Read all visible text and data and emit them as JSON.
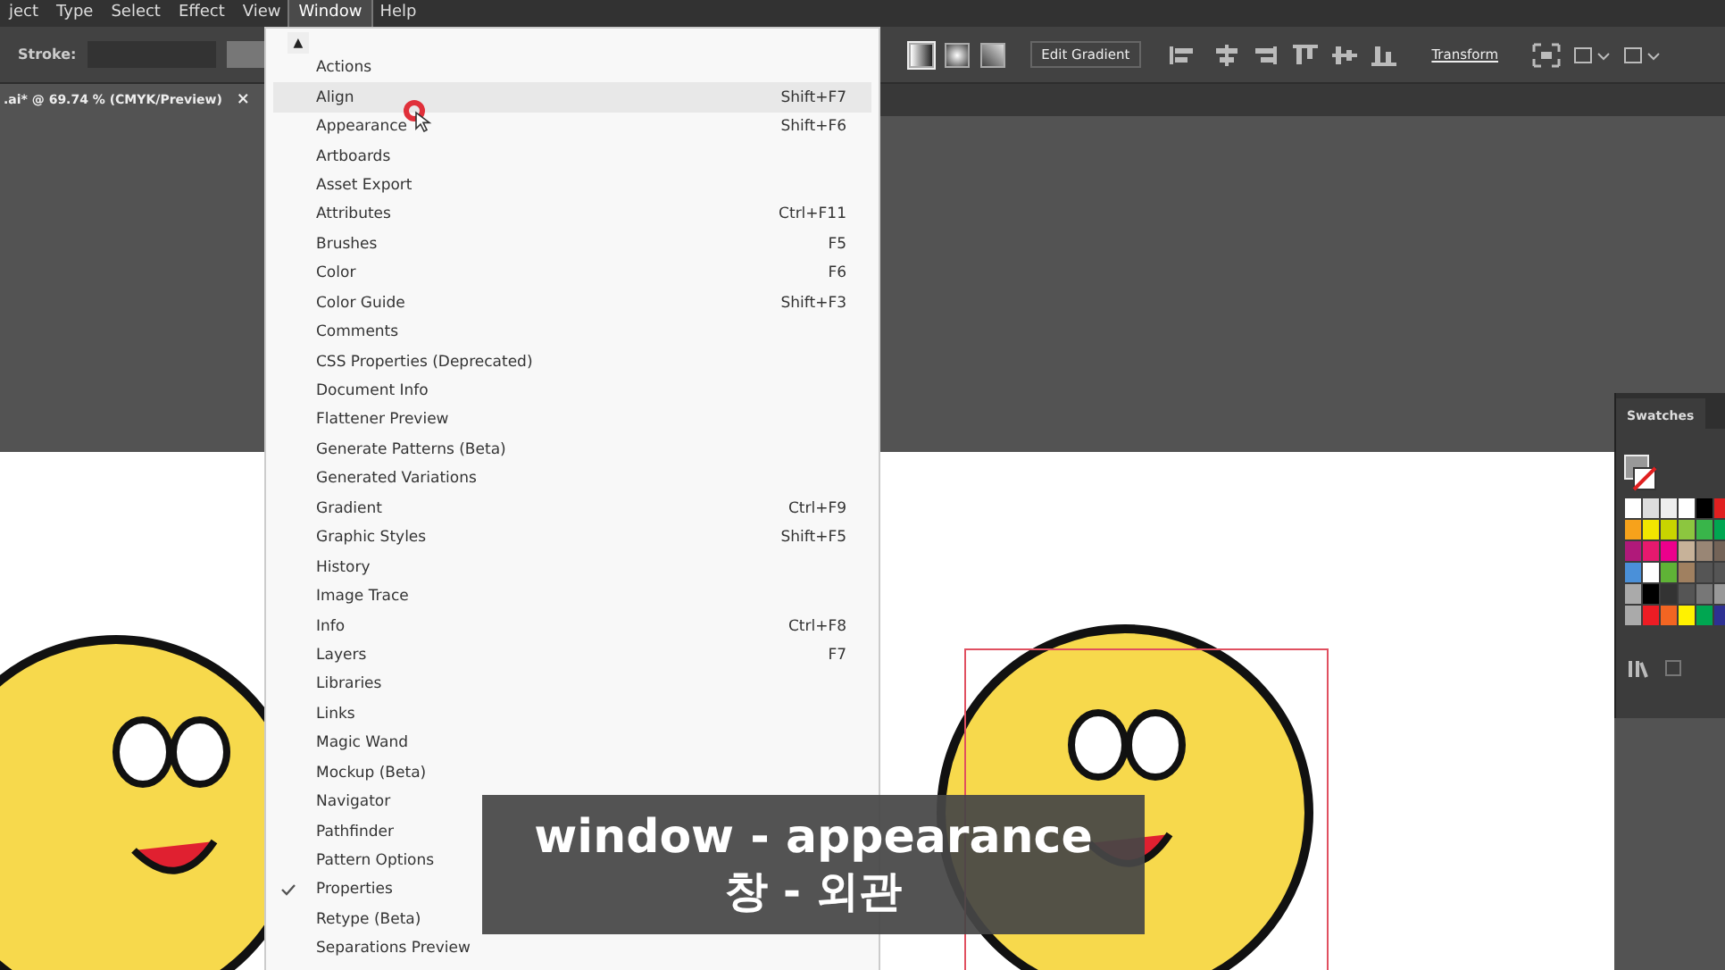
{
  "menu_bar": [
    {
      "label": "ject",
      "selected": false
    },
    {
      "label": "Type",
      "selected": false
    },
    {
      "label": "Select",
      "selected": false
    },
    {
      "label": "Effect",
      "selected": false
    },
    {
      "label": "View",
      "selected": false
    },
    {
      "label": "Window",
      "selected": true
    },
    {
      "label": "Help",
      "selected": false
    }
  ],
  "control_bar": {
    "stroke_label": "Stroke:",
    "edit_gradient": "Edit Gradient",
    "transform": "Transform"
  },
  "document_tab": {
    "title": ".ai* @ 69.74 % (CMYK/Preview)",
    "close": "×"
  },
  "window_menu": {
    "scroll_up": "▲",
    "items": [
      {
        "label": "Actions",
        "checked": false,
        "highlighted": false
      },
      {
        "label": "Align",
        "shortcut": "Shift+F7",
        "checked": false,
        "highlighted": true
      },
      {
        "label": "Appearance",
        "shortcut": "Shift+F6",
        "checked": false,
        "highlighted": false
      },
      {
        "label": "Artboards",
        "checked": false,
        "highlighted": false
      },
      {
        "label": "Asset Export",
        "checked": false,
        "highlighted": false
      },
      {
        "label": "Attributes",
        "shortcut": "Ctrl+F11",
        "checked": false,
        "highlighted": false
      },
      {
        "label": "Brushes",
        "shortcut": "F5",
        "checked": false,
        "highlighted": false
      },
      {
        "label": "Color",
        "shortcut": "F6",
        "checked": false,
        "highlighted": false
      },
      {
        "label": "Color Guide",
        "shortcut": "Shift+F3",
        "checked": false,
        "highlighted": false
      },
      {
        "label": "Comments",
        "checked": false,
        "highlighted": false
      },
      {
        "label": "CSS Properties (Deprecated)",
        "checked": false,
        "highlighted": false
      },
      {
        "label": "Document Info",
        "checked": false,
        "highlighted": false
      },
      {
        "label": "Flattener Preview",
        "checked": false,
        "highlighted": false
      },
      {
        "label": "Generate Patterns (Beta)",
        "checked": false,
        "highlighted": false
      },
      {
        "label": "Generated Variations",
        "checked": false,
        "highlighted": false
      },
      {
        "label": "Gradient",
        "shortcut": "Ctrl+F9",
        "checked": false,
        "highlighted": false
      },
      {
        "label": "Graphic Styles",
        "shortcut": "Shift+F5",
        "checked": false,
        "highlighted": false
      },
      {
        "label": "History",
        "checked": false,
        "highlighted": false
      },
      {
        "label": "Image Trace",
        "checked": false,
        "highlighted": false
      },
      {
        "label": "Info",
        "shortcut": "Ctrl+F8",
        "checked": false,
        "highlighted": false
      },
      {
        "label": "Layers",
        "shortcut": "F7",
        "checked": false,
        "highlighted": false
      },
      {
        "label": "Libraries",
        "checked": false,
        "highlighted": false
      },
      {
        "label": "Links",
        "checked": false,
        "highlighted": false
      },
      {
        "label": "Magic Wand",
        "checked": false,
        "highlighted": false
      },
      {
        "label": "Mockup (Beta)",
        "checked": false,
        "highlighted": false
      },
      {
        "label": "Navigator",
        "checked": false,
        "highlighted": false
      },
      {
        "label": "Pathfinder",
        "checked": false,
        "highlighted": false
      },
      {
        "label": "Pattern Options",
        "checked": false,
        "highlighted": false
      },
      {
        "label": "Properties",
        "checked": true,
        "highlighted": false
      },
      {
        "label": "Retype (Beta)",
        "checked": false,
        "highlighted": false
      },
      {
        "label": "Separations Preview",
        "checked": false,
        "highlighted": false
      }
    ]
  },
  "swatches_panel": {
    "title": "Swatches"
  },
  "caption": {
    "line_1": "window - appearance",
    "line_2": "창 - 외관"
  }
}
